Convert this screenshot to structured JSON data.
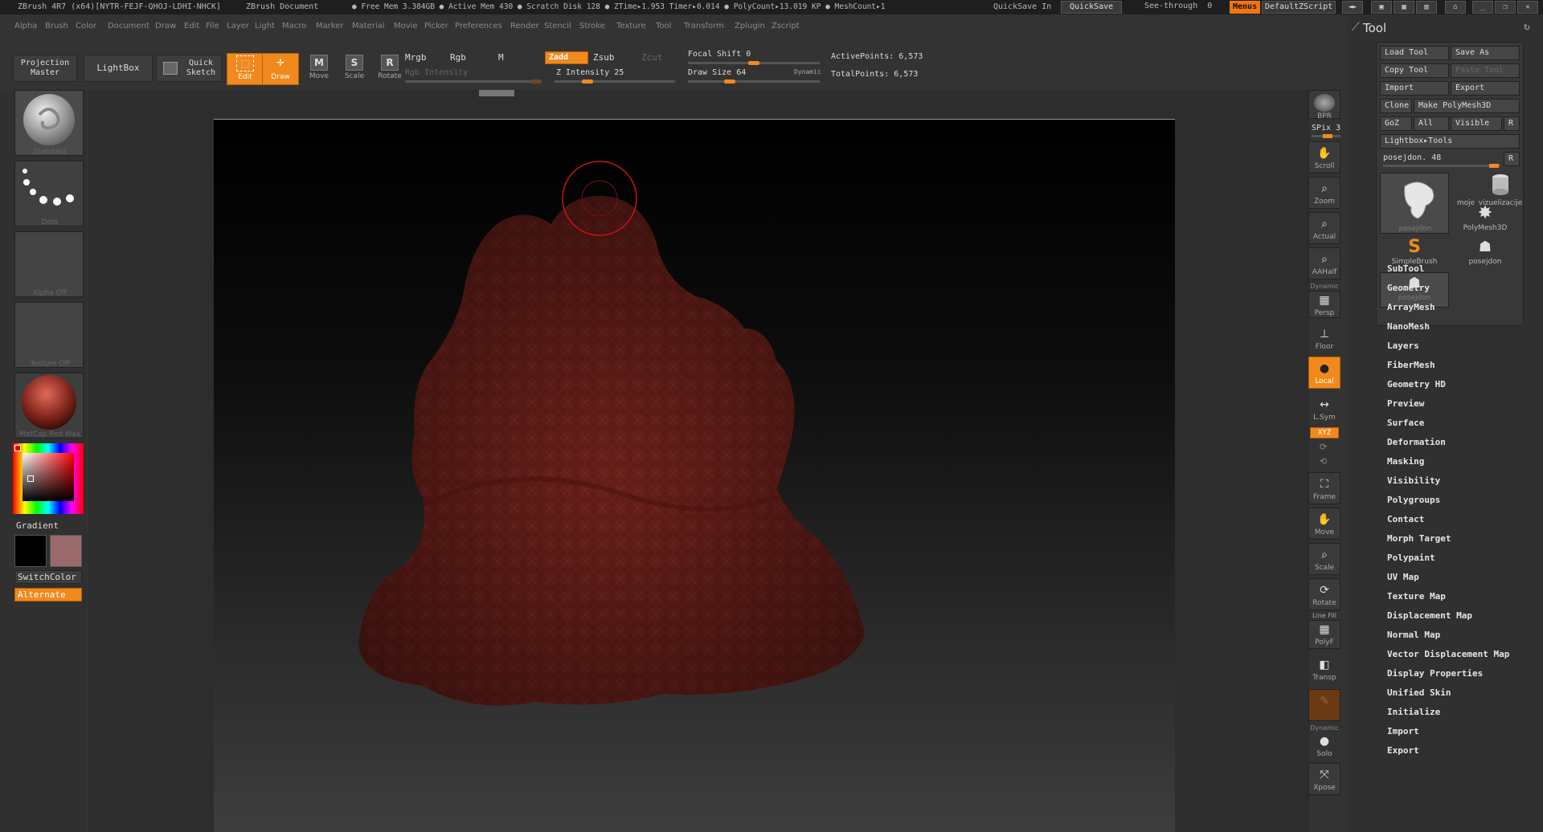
{
  "titlebar": {
    "app": "ZBrush 4R7 (x64)[NYTR-FEJF-QHOJ-LDHI-NHCK]",
    "doc": "ZBrush Document",
    "stats": "● Free Mem 3.384GB ● Active Mem 430 ● Scratch Disk 128 ● ZTime▸1.953 Timer▸0.014 ● PolyCount▸13.019 KP ● MeshCount▸1",
    "quicksave_in": "QuickSave In",
    "quicksave": "QuickSave",
    "seethrough": "See-through",
    "seethrough_value": "0",
    "menus": "Menus",
    "script": "DefaultZScript"
  },
  "menubar": [
    "Alpha",
    "Brush",
    "Color",
    "Document",
    "Draw",
    "Edit",
    "File",
    "Layer",
    "Light",
    "Macro",
    "Marker",
    "Material",
    "Movie",
    "Picker",
    "Preferences",
    "Render",
    "Stencil",
    "Stroke",
    "Texture",
    "Tool",
    "Transform",
    "Zplugin",
    "Zscript"
  ],
  "toolbar": {
    "projection_master": "Projection Master",
    "lightbox": "LightBox",
    "quick_sketch": "Quick Sketch",
    "edit": "Edit",
    "draw": "Draw",
    "move": "Move",
    "scale": "Scale",
    "rotate": "Rotate",
    "mrgb": "Mrgb",
    "rgb": "Rgb",
    "m": "M",
    "rgb_intensity": "Rgb Intensity",
    "zadd": "Zadd",
    "zsub": "Zsub",
    "zcut": "Zcut",
    "z_intensity": "Z Intensity 25",
    "z_intensity_value": 0.25,
    "focal_shift": "Focal Shift 0",
    "focal_shift_value": 0.5,
    "draw_size": "Draw Size 64",
    "draw_size_value": 0.3,
    "dynamic": "Dynamic",
    "active_points": "ActivePoints: 6,573",
    "total_points": "TotalPoints: 6,573"
  },
  "leftshelf": {
    "brush": "Standard",
    "stroke": "Dots",
    "alpha": "Alpha Off",
    "texture": "Texture Off",
    "material": "MatCap Red Wax",
    "gradient": "Gradient",
    "switchcolor": "SwitchColor",
    "alternate": "Alternate"
  },
  "rightshelf": [
    "BPR",
    "SPix 3",
    "Scroll",
    "Zoom",
    "Actual",
    "AAHalf",
    "Persp",
    "Floor",
    "Local",
    "L.Sym",
    "XYZ",
    "Frame",
    "Move",
    "Scale",
    "Rotate",
    "PolyF",
    "Transp",
    "Solo",
    "Xpose"
  ],
  "rightshelf_extra": {
    "dynamic1": "Dynamic",
    "linefill": "Line Fill",
    "dynamic2": "Dynamic"
  },
  "toolpanel": {
    "title": "Tool",
    "load_tool": "Load Tool",
    "save_as": "Save As",
    "copy_tool": "Copy Tool",
    "paste_tool": "Paste Tool",
    "import": "Import",
    "export": "Export",
    "clone": "Clone",
    "make_polymesh": "Make PolyMesh3D",
    "goz": "GoZ",
    "all": "All",
    "visible": "Visible",
    "r": "R",
    "lightbox_tools": "Lightbox▸Tools",
    "current_tool": "posejdon. 48",
    "tools": [
      "posejdon",
      "moje",
      "vizuelizacije",
      "PolyMesh3D",
      "SimpleBrush",
      "posejdon",
      "posejdon"
    ]
  },
  "sections": [
    "SubTool",
    "Geometry",
    "ArrayMesh",
    "NanoMesh",
    "Layers",
    "FiberMesh",
    "Geometry HD",
    "Preview",
    "Surface",
    "Deformation",
    "Masking",
    "Visibility",
    "Polygroups",
    "Contact",
    "Morph Target",
    "Polypaint",
    "UV Map",
    "Texture Map",
    "Displacement Map",
    "Normal Map",
    "Vector Displacement Map",
    "Display Properties",
    "Unified Skin",
    "Initialize",
    "Import",
    "Export"
  ],
  "colors": {
    "accent": "#f08a1c",
    "mesh": "#6b201b",
    "bg": "#333333"
  }
}
